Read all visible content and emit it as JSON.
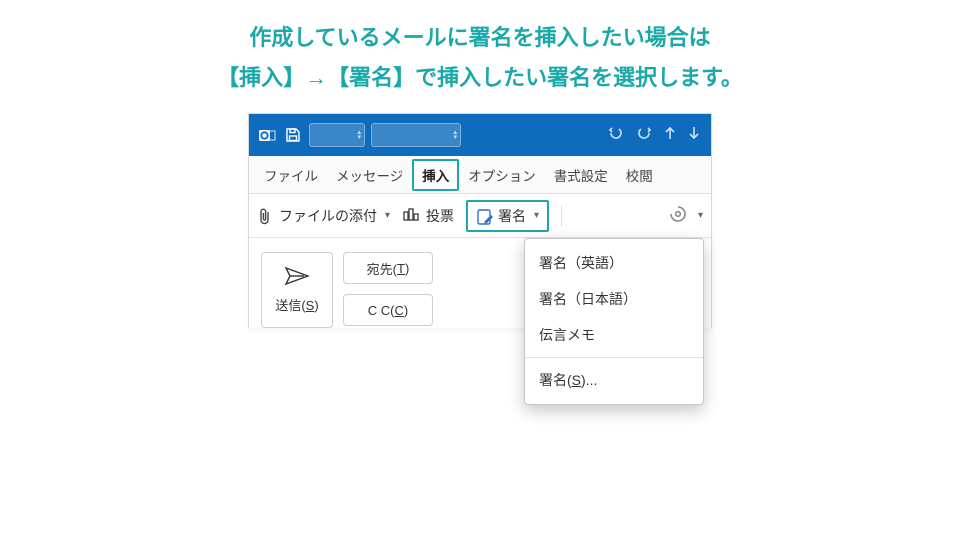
{
  "instruction": {
    "line1": "作成しているメールに署名を挿入したい場合は",
    "line2": "【挿入】→【署名】で挿入したい署名を選択します。"
  },
  "tabs": {
    "file": "ファイル",
    "message": "メッセージ",
    "insert": "挿入",
    "options": "オプション",
    "format": "書式設定",
    "review": "校閲"
  },
  "ribbon": {
    "attach": "ファイルの添付",
    "vote": "投票",
    "signature": "署名"
  },
  "dropdown": {
    "item1": "署名（英語）",
    "item2": "署名（日本語）",
    "item3": "伝言メモ",
    "item4_prefix": "署名(",
    "item4_u": "S",
    "item4_suffix": ")..."
  },
  "compose": {
    "send_prefix": "送信(",
    "send_u": "S",
    "send_suffix": ")",
    "to_prefix": "宛先(",
    "to_u": "T",
    "to_suffix": ")",
    "cc_prefix": "C C(",
    "cc_u": "C",
    "cc_suffix": ")"
  }
}
